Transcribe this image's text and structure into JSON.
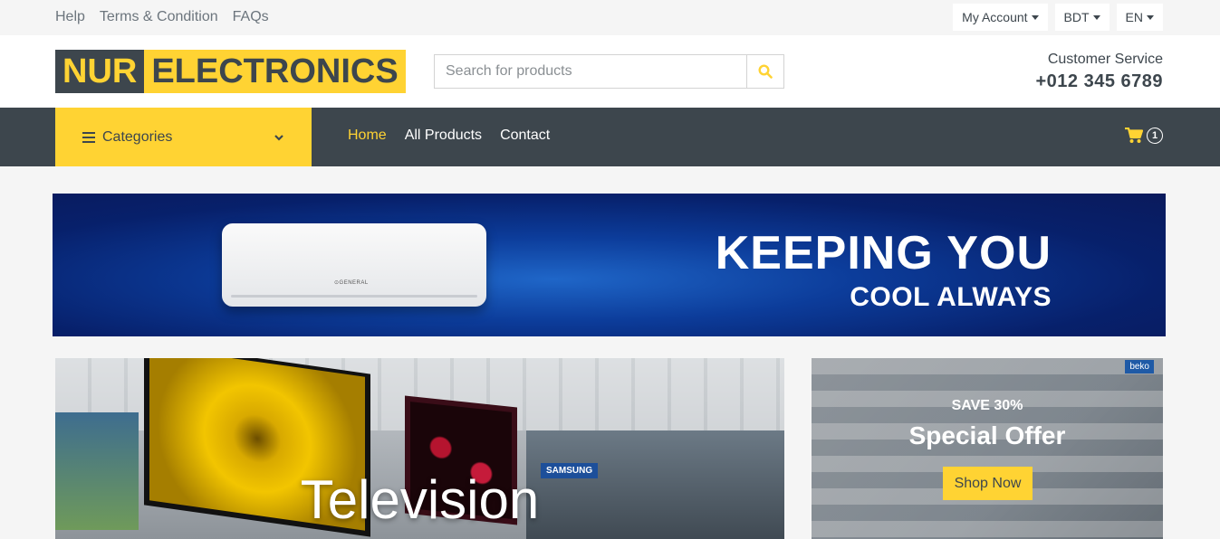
{
  "topbar": {
    "links": [
      "Help",
      "Terms & Condition",
      "FAQs"
    ],
    "account_label": "My Account",
    "currency_label": "BDT",
    "language_label": "EN"
  },
  "header": {
    "logo_part1": "NUR",
    "logo_part2": "ELECTRONICS",
    "search_placeholder": "Search for products",
    "customer_service_label": "Customer Service",
    "phone": "+012 345 6789"
  },
  "nav": {
    "categories_label": "Categories",
    "links": [
      "Home",
      "All Products",
      "Contact"
    ],
    "active_link": "Home",
    "cart_count": "1"
  },
  "banner": {
    "line1": "KEEPING YOU",
    "line2": "COOL ALWAYS",
    "ac_brand": "⊙GENERAL"
  },
  "cards": {
    "television_title": "Television",
    "tv_store_brand": "SAMSUNG",
    "offer_brand": "beko",
    "offer_discount": "SAVE 30%",
    "offer_title": "Special Offer",
    "offer_button": "Shop Now"
  },
  "colors": {
    "accent": "#ffd333",
    "dark": "#3d464d",
    "background": "#f5f5f5"
  },
  "icons": {
    "menu": "bars-icon",
    "dropdown": "chevron-down-icon",
    "search": "search-icon",
    "cart": "shopping-cart-icon"
  }
}
